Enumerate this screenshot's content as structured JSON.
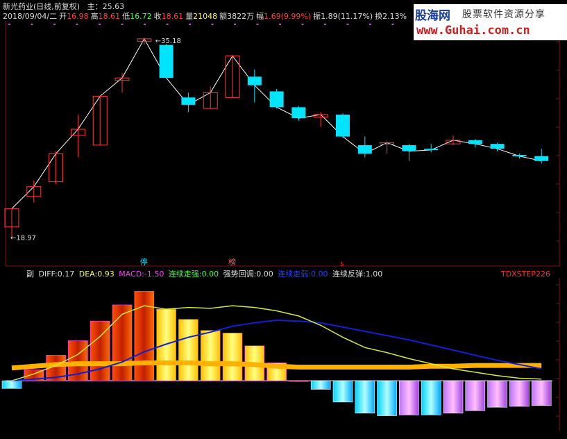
{
  "header": {
    "stock": "新光药业(日线,前复权)",
    "indicator_main": "主：25.63",
    "date": "2018/09/04/二",
    "open_label": "开",
    "open": "16.98",
    "high_label": "高",
    "high": "18.61",
    "low_label": "低",
    "low": "16.72",
    "close_label": "收",
    "close": "18.61",
    "vol_label": "量",
    "vol": "21048",
    "amt_label": "额",
    "amt": "3822万",
    "chg_label": "幅",
    "chg": "1.69(9.99%)",
    "amp_label": "振",
    "amp": "1.89(11.17%)",
    "turn_label": "换",
    "turn": "2.13%"
  },
  "logo": {
    "name": "股海网",
    "slogan": "股票软件资源分享",
    "url": "www.Guhai.com.cn"
  },
  "markers": {
    "limit_up": "停",
    "rank": "榜",
    "red_s": "$"
  },
  "sub": {
    "title": "副",
    "diff_label": "DIFF:",
    "diff": "0.17",
    "dea_label": "DEA:",
    "dea": "0.93",
    "macd_label": "MACD:",
    "macd": "-1.50",
    "strong_label": "连续走强:",
    "strong": "0.00",
    "pullback_label": "强势回调:",
    "pullback": "0.00",
    "weak_label": "连续走弱:",
    "weak": "0.00",
    "rebound_label": "连续反弹:",
    "rebound": "1.00",
    "indicator_name": "TDXSTEP226"
  },
  "colors": {
    "up": "#ff3c3c",
    "down": "#00e5ff",
    "bg": "#000000",
    "grid": "#801010"
  },
  "chart_data": [
    {
      "type": "candlestick",
      "title": "新光药业(日线,前复权)",
      "annotations": {
        "max": "35.18",
        "min": "18.97"
      },
      "ylim": [
        17.0,
        36.5
      ],
      "candles": [
        {
          "o": 19.8,
          "c": 21.3,
          "h": 21.3,
          "l": 19.0,
          "up": true
        },
        {
          "o": 22.3,
          "c": 23.1,
          "h": 23.6,
          "l": 21.8,
          "up": true
        },
        {
          "o": 23.5,
          "c": 25.8,
          "h": 26.0,
          "l": 23.3,
          "up": true
        },
        {
          "o": 27.3,
          "c": 27.8,
          "h": 29.0,
          "l": 25.5,
          "up": true
        },
        {
          "o": 26.5,
          "c": 30.5,
          "h": 30.5,
          "l": 26.5,
          "up": true
        },
        {
          "o": 31.8,
          "c": 32.0,
          "h": 32.4,
          "l": 30.8,
          "up": true
        },
        {
          "o": 35.0,
          "c": 35.2,
          "h": 35.3,
          "l": 34.7,
          "up": true
        },
        {
          "o": 34.7,
          "c": 32.0,
          "h": 34.8,
          "l": 32.0,
          "down": true
        },
        {
          "o": 30.4,
          "c": 29.8,
          "h": 30.8,
          "l": 29.2,
          "down": true
        },
        {
          "o": 29.5,
          "c": 30.8,
          "h": 31.3,
          "l": 29.5,
          "up": true
        },
        {
          "o": 30.4,
          "c": 33.8,
          "h": 33.9,
          "l": 30.4,
          "up": true
        },
        {
          "o": 32.1,
          "c": 31.4,
          "h": 32.7,
          "l": 30.0,
          "down": true
        },
        {
          "o": 30.9,
          "c": 29.6,
          "h": 31.1,
          "l": 29.5,
          "down": true
        },
        {
          "o": 29.6,
          "c": 28.7,
          "h": 29.7,
          "l": 28.5,
          "down": true
        },
        {
          "o": 28.8,
          "c": 29.0,
          "h": 29.2,
          "l": 28.0,
          "up": true
        },
        {
          "o": 29.0,
          "c": 27.2,
          "h": 29.1,
          "l": 27.1,
          "down": true
        },
        {
          "o": 26.5,
          "c": 25.8,
          "h": 27.2,
          "l": 25.5,
          "down": true
        },
        {
          "o": 26.6,
          "c": 26.7,
          "h": 26.8,
          "l": 25.8,
          "up": true
        },
        {
          "o": 26.5,
          "c": 26.0,
          "h": 26.6,
          "l": 25.2,
          "down": true
        },
        {
          "o": 26.2,
          "c": 26.1,
          "h": 26.6,
          "l": 25.9,
          "down": true
        },
        {
          "o": 26.6,
          "c": 26.9,
          "h": 27.3,
          "l": 26.5,
          "up": true
        },
        {
          "o": 26.9,
          "c": 26.6,
          "h": 27.0,
          "l": 26.3,
          "down": true
        },
        {
          "o": 26.6,
          "c": 26.2,
          "h": 26.7,
          "l": 26.0,
          "down": true
        },
        {
          "o": 25.7,
          "c": 25.6,
          "h": 25.8,
          "l": 25.4,
          "down": true
        },
        {
          "o": 25.6,
          "c": 25.2,
          "h": 26.2,
          "l": 25.0,
          "down": true
        }
      ]
    },
    {
      "type": "bar",
      "title": "副",
      "series": [
        {
          "name": "DIFF",
          "values": [
            0.0,
            0.8,
            1.8,
            3.1,
            5.2,
            7.8,
            8.8,
            8.4,
            8.6,
            8.5,
            8.8,
            8.6,
            8.2,
            7.6,
            6.5,
            5.1,
            3.9,
            3.3,
            2.6,
            2.0,
            1.4,
            1.0,
            0.6,
            0.3,
            0.2
          ]
        },
        {
          "name": "DEA",
          "values": [
            0.0,
            0.2,
            0.4,
            0.8,
            1.4,
            2.2,
            3.4,
            4.3,
            5.1,
            5.7,
            6.4,
            6.8,
            7.1,
            7.0,
            6.8,
            6.3,
            5.8,
            5.3,
            4.8,
            4.2,
            3.6,
            3.0,
            2.4,
            1.9,
            1.4
          ]
        },
        {
          "name": "MACD",
          "values": [
            -0.9,
            1.3,
            3.0,
            4.7,
            7.0,
            8.9,
            10.5,
            8.4,
            7.2,
            5.9,
            5.6,
            4.1,
            2.1,
            0.0,
            -1.0,
            -2.5,
            -3.8,
            -4.1,
            -4.0,
            -4.0,
            -3.8,
            -3.5,
            -3.1,
            -3.0,
            -2.9
          ]
        }
      ],
      "step_band": [
        1.5,
        1.7,
        1.9,
        2.0,
        2.0,
        2.0,
        2.1,
        2.1,
        2.1,
        2.0,
        2.0,
        1.9,
        1.7,
        1.6,
        1.6,
        1.6,
        1.6,
        1.6,
        1.6,
        1.7,
        1.7,
        1.8,
        1.8,
        1.8,
        1.8
      ],
      "ylim": [
        -5.2,
        11.5
      ]
    }
  ]
}
